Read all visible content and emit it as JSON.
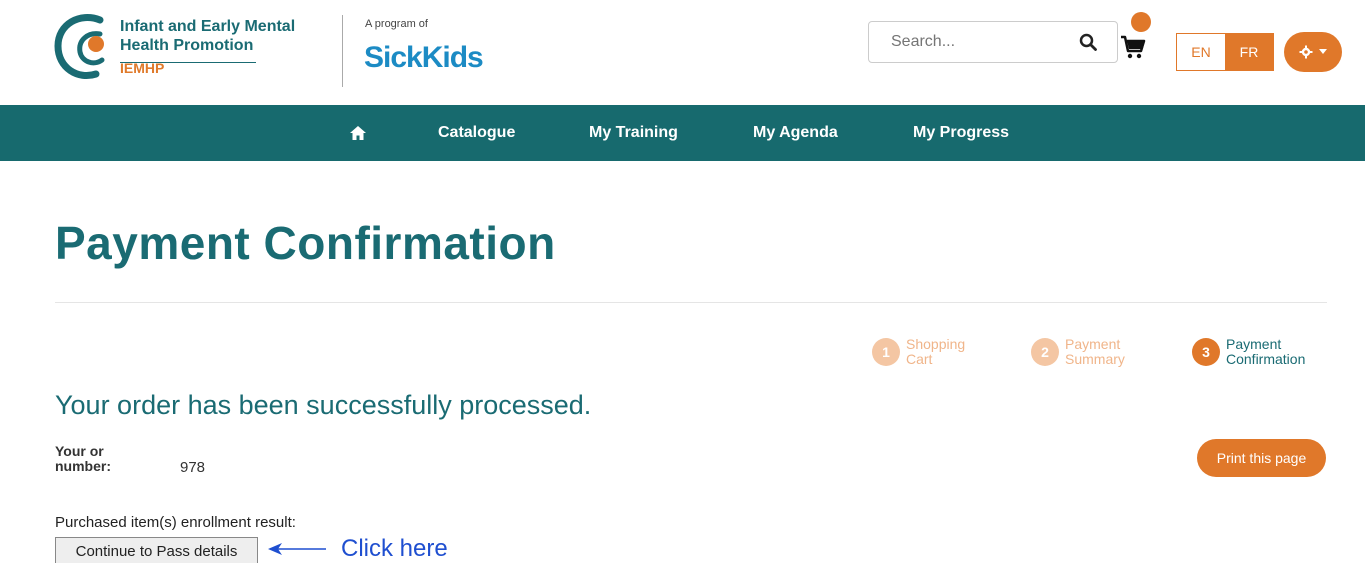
{
  "brand": {
    "line1": "Infant and Early Mental",
    "line2": "Health Promotion",
    "abbr": "IEMHP",
    "program_of": "A program of",
    "partner": "SickKids"
  },
  "search": {
    "placeholder": "Search..."
  },
  "language": {
    "en": "EN",
    "fr": "FR"
  },
  "nav": {
    "items": [
      {
        "label": "Catalogue"
      },
      {
        "label": "My Training"
      },
      {
        "label": "My Agenda"
      },
      {
        "label": "My Progress"
      }
    ]
  },
  "page": {
    "title": "Payment Confirmation",
    "success_message": "Your order has been successfully processed.",
    "order_label": "Your or\nnumber:",
    "order_number": "978",
    "print_label": "Print this page",
    "enroll_label": "Purchased item(s) enrollment result:",
    "continue_label": "Continue to Pass details",
    "annotation": "Click here"
  },
  "steps": [
    {
      "num": "1",
      "label": "Shopping\nCart",
      "state": "inactive"
    },
    {
      "num": "2",
      "label": "Payment\nSummary",
      "state": "inactive"
    },
    {
      "num": "3",
      "label": "Payment\nConfirmation",
      "state": "active"
    }
  ],
  "colors": {
    "primary": "#176a6e",
    "accent": "#e0782a",
    "annotation": "#1f4fd0"
  },
  "icons": {
    "home": "home-icon",
    "search": "search-icon",
    "cart": "cart-icon",
    "settings": "gear-icon"
  }
}
